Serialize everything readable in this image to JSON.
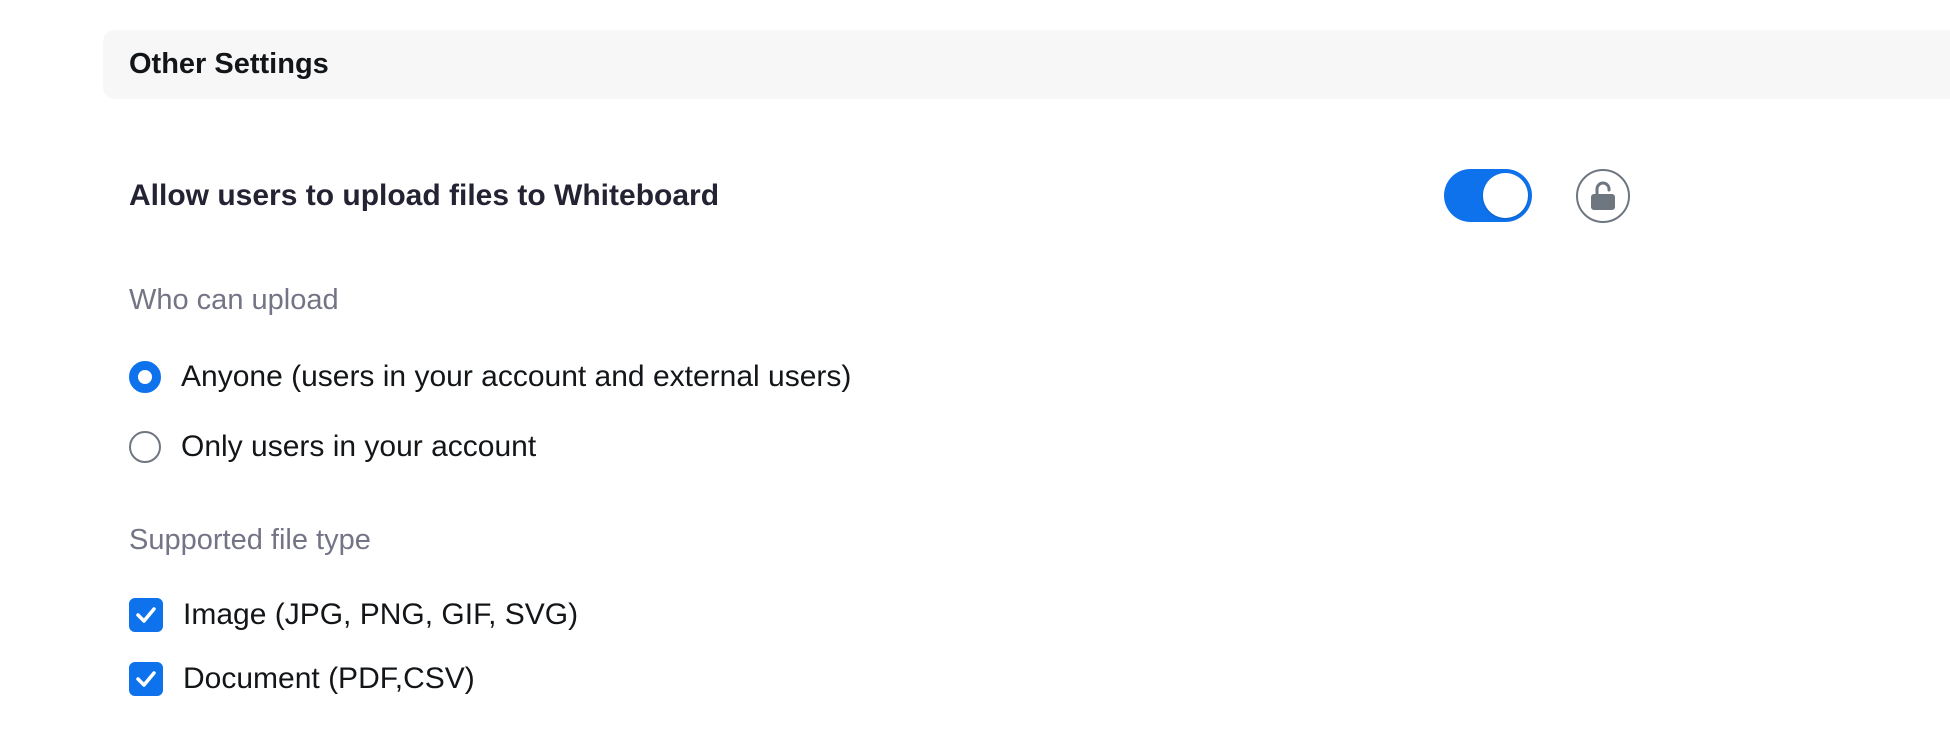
{
  "section": {
    "title": "Other Settings"
  },
  "setting": {
    "title": "Allow users to upload files to Whiteboard",
    "toggle_on": true,
    "lock_icon": "lock-open-icon"
  },
  "who_can_upload": {
    "label": "Who can upload",
    "options": [
      {
        "label": "Anyone (users in your account and external users)",
        "selected": true
      },
      {
        "label": "Only users in your account",
        "selected": false
      }
    ]
  },
  "file_types": {
    "label": "Supported file type",
    "options": [
      {
        "label": "Image (JPG, PNG, GIF, SVG)",
        "checked": true
      },
      {
        "label": "Document (PDF,CSV)",
        "checked": true
      }
    ]
  },
  "colors": {
    "accent": "#0e72ed",
    "header_bg": "#f7f7f8",
    "muted_text": "#747487"
  }
}
